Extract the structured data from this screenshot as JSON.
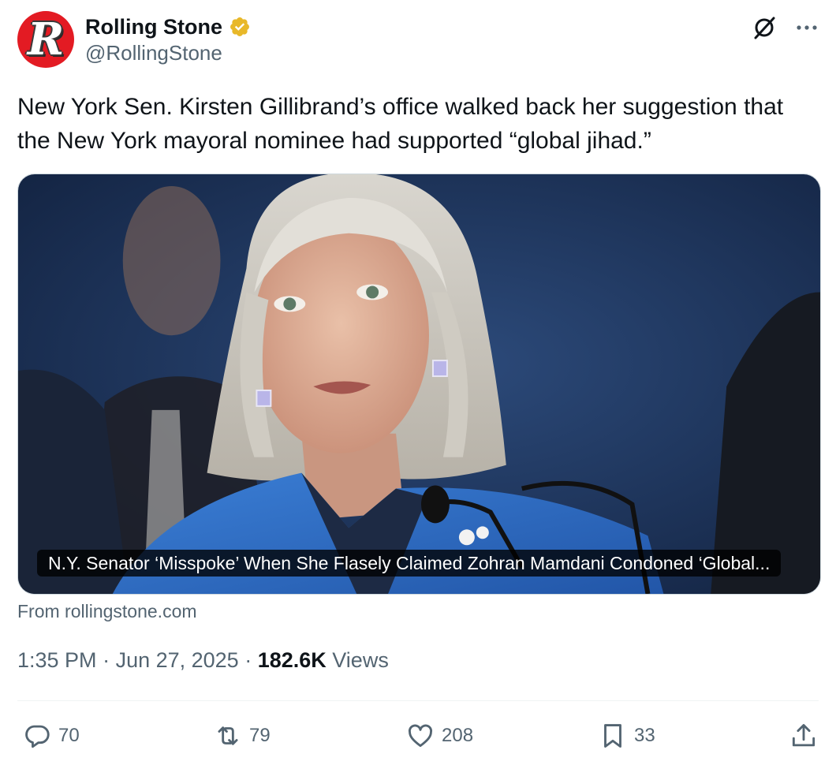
{
  "author": {
    "avatar_letter": "R",
    "display_name": "Rolling Stone",
    "handle": "@RollingStone",
    "verified": true,
    "avatar_color": "#e31b23",
    "verified_color": "#e8b829"
  },
  "tweet": {
    "text": "New York Sen. Kirsten Gillibrand’s office walked back her suggestion that the New York mayoral nominee had supported “global jihad.”"
  },
  "card": {
    "headline": "N.Y. Senator ‘Misspoke’ When She Flasely Claimed Zohran Mamdani Condoned ‘Global...",
    "source": "From rollingstone.com"
  },
  "meta": {
    "time": "1:35 PM",
    "sep1": " · ",
    "date": "Jun 27, 2025",
    "sep2": " · ",
    "views_count": "182.6K",
    "views_label": " Views"
  },
  "actions": {
    "replies": "70",
    "reposts": "79",
    "likes": "208",
    "bookmarks": "33"
  },
  "icons": {
    "grok": "grok-icon",
    "more": "more-icon",
    "reply": "reply-icon",
    "repost": "repost-icon",
    "like": "heart-icon",
    "bookmark": "bookmark-icon",
    "share": "share-icon"
  }
}
